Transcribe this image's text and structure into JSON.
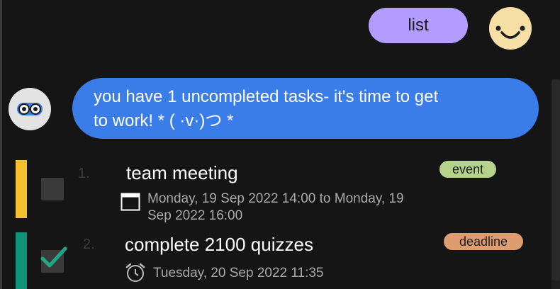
{
  "chat": {
    "user_message": "list",
    "bot_message_line1": "you have 1 uncompleted tasks- it's time to get",
    "bot_message_line2": "to work! * ( ·v·)つ *"
  },
  "tasks": [
    {
      "number": "1.",
      "title": "team meeting",
      "tag": "event",
      "tag_color": "#b6d38c",
      "bar_color": "#f4c02f",
      "completed": false,
      "time_icon": "calendar-icon",
      "time_line1": "Monday, 19 Sep 2022 14:00 to Monday, 19",
      "time_line2": "Sep 2022 16:00"
    },
    {
      "number": "2.",
      "title": "complete 2100 quizzes",
      "tag": "deadline",
      "tag_color": "#de9d70",
      "bar_color": "#11937a",
      "completed": true,
      "time_icon": "alarm-clock-icon",
      "time_line1": "Tuesday, 20 Sep 2022 11:35"
    }
  ],
  "colors": {
    "background": "#151515",
    "user_bubble": "#b39cff",
    "bot_bubble": "#3b7de8",
    "checkmark": "#1fa887"
  }
}
